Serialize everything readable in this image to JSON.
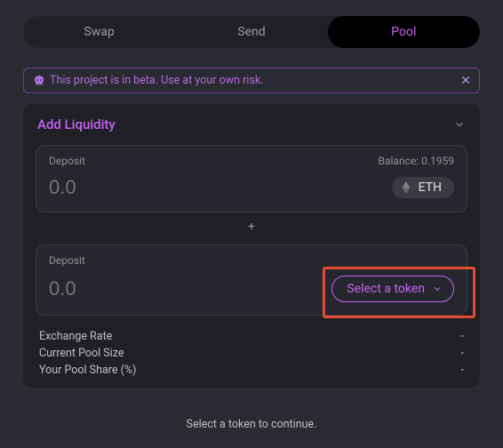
{
  "tabs": {
    "swap": "Swap",
    "send": "Send",
    "pool": "Pool"
  },
  "notice": {
    "text": "This project is in beta. Use at your own risk."
  },
  "panel": {
    "title": "Add Liquidity",
    "deposit1": {
      "label": "Deposit",
      "balance_label": "Balance: 0.1959",
      "amount_placeholder": "0.0",
      "token": "ETH"
    },
    "plus": "+",
    "deposit2": {
      "label": "Deposit",
      "amount_placeholder": "0.0",
      "select_label": "Select a token"
    },
    "meta": {
      "exchange_rate_label": "Exchange Rate",
      "exchange_rate_value": "-",
      "pool_size_label": "Current Pool Size",
      "pool_size_value": "-",
      "pool_share_label": "Your Pool Share (%)",
      "pool_share_value": "-"
    }
  },
  "continue_msg": "Select a token to continue."
}
